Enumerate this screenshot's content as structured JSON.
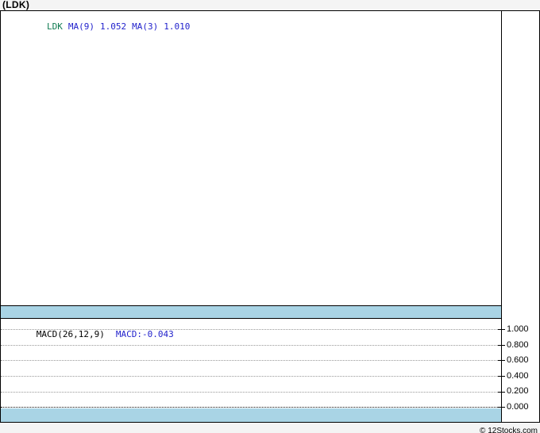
{
  "window": {
    "title": "(LDK)"
  },
  "price_panel": {
    "legend": {
      "symbol": "LDK",
      "ma9_label": "MA(9)",
      "ma9_value": "1.052",
      "ma3_label": "MA(3)",
      "ma3_value": "1.010"
    }
  },
  "macd_panel": {
    "legend": {
      "label": "MACD(26,12,9)",
      "value": "MACD:-0.043"
    },
    "y_axis": {
      "ticks": [
        "1.000",
        "0.800",
        "0.600",
        "0.400",
        "0.200",
        "0.000"
      ]
    }
  },
  "footer": {
    "attribution": "© 12Stocks.com"
  },
  "colors": {
    "date_strip_blue": "#a9d4e5",
    "legend_blue": "#2222cc",
    "symbol_green": "#0e7a50",
    "page_background": "#f4f4f4",
    "panel_background": "#ffffff",
    "border_black": "#000000",
    "gridline_gray": "#999999"
  },
  "chart_data": [
    {
      "type": "line",
      "title": "(LDK)",
      "panel": "price",
      "legend": [
        "LDK",
        "MA(9)",
        "MA(3)"
      ],
      "indicator_values": {
        "MA(9)": 1.052,
        "MA(3)": 1.01
      },
      "series": [],
      "note": "price panel is empty - no plotted candles/lines visible",
      "grid": false,
      "legend_position": "top-left"
    },
    {
      "type": "line",
      "title": "MACD(26,12,9)",
      "panel": "macd",
      "legend": [
        "MACD(26,12,9)"
      ],
      "indicator_values": {
        "MACD": -0.043
      },
      "ylim": [
        0.0,
        1.0
      ],
      "yticks": [
        1.0,
        0.8,
        0.6,
        0.4,
        0.2,
        0.0
      ],
      "series": [],
      "note": "MACD panel shows horizontal dotted gridlines only, zero line emphasized, no plotted series visible",
      "grid": true,
      "legend_position": "top-left",
      "y_axis_position": "right"
    }
  ]
}
